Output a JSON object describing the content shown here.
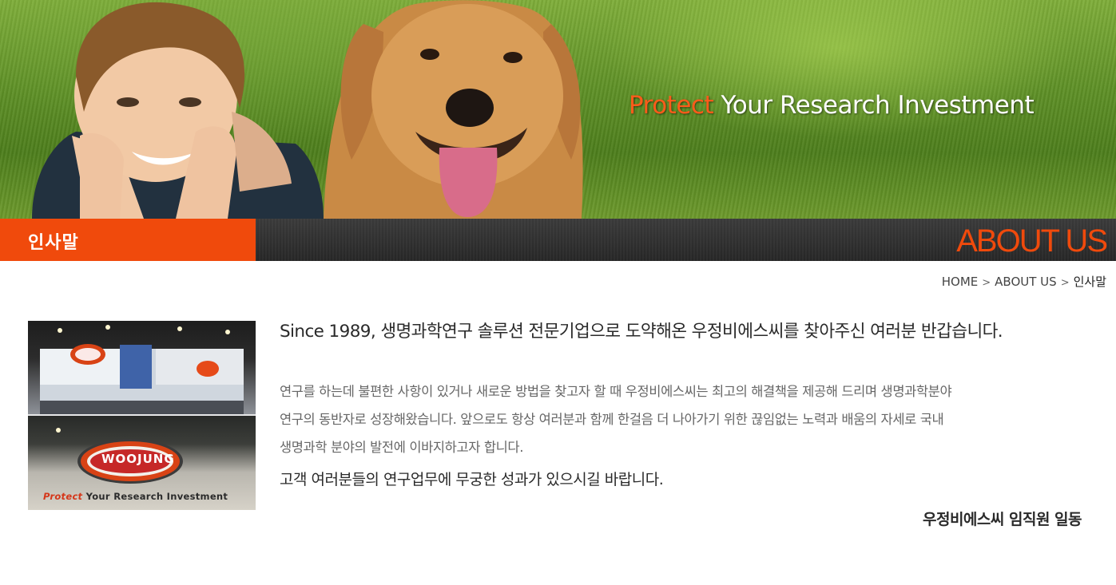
{
  "banner": {
    "tagline_accent": "Protect",
    "tagline_rest": " Your Research Investment"
  },
  "section_bar": {
    "current_tab": "인사말",
    "title": "ABOUT US"
  },
  "breadcrumb": {
    "items": [
      "HOME",
      "ABOUT US",
      "인사말"
    ],
    "separator": ">"
  },
  "photo": {
    "logo_text": "WOOJUNG",
    "caption_accent": "Protect",
    "caption_rest": " Your Research Investment"
  },
  "greeting": {
    "headline": "Since 1989, 생명과학연구 솔루션 전문기업으로 도약해온 우정비에스씨를 찾아주신 여러분 반갑습니다.",
    "body_lines": [
      "연구를 하는데 불편한 사항이 있거나 새로운 방법을 찾고자 할 때 우정비에스씨는 최고의 해결책을 제공해 드리며 생명과학분야",
      "연구의 동반자로 성장해왔습니다. 앞으로도 항상 여러분과 함께 한걸음 더 나아가기 위한 끊임없는 노력과 배움의 자세로 국내",
      "생명과학 분야의 발전에 이바지하고자 합니다."
    ],
    "closing": "고객 여러분들의 연구업무에 무궁한 성과가 있으시길 바랍니다.",
    "signature": "우정비에스씨 임직원 일동"
  },
  "colors": {
    "accent_orange": "#f04a0c",
    "bar_dark": "#2a2a2a"
  }
}
